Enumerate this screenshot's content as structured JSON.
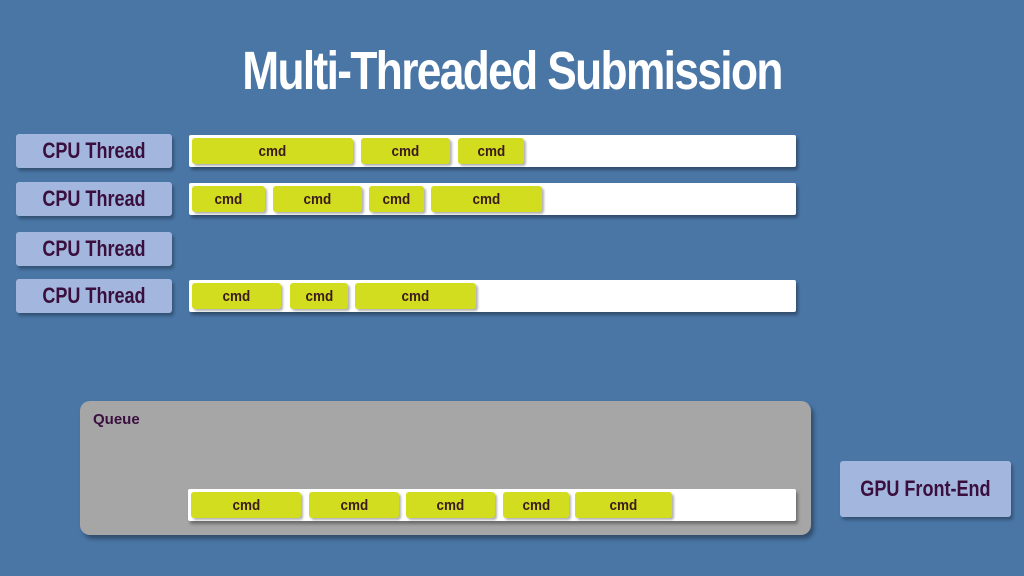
{
  "title": "Multi-Threaded Submission",
  "threads": [
    {
      "label": "CPU Thread",
      "cmds": [
        "cmd",
        "cmd",
        "cmd"
      ]
    },
    {
      "label": "CPU Thread",
      "cmds": [
        "cmd",
        "cmd",
        "cmd",
        "cmd"
      ]
    },
    {
      "label": "CPU Thread",
      "cmds": []
    },
    {
      "label": "CPU Thread",
      "cmds": [
        "cmd",
        "cmd",
        "cmd"
      ]
    }
  ],
  "queue": {
    "label": "Queue",
    "cmds": [
      "cmd",
      "cmd",
      "cmd",
      "cmd",
      "cmd"
    ]
  },
  "gpu": {
    "label": "GPU Front-End"
  },
  "colors": {
    "background": "#4a76a6",
    "label_box": "#a3b7de",
    "cmd": "#d2dd20",
    "queue": "#a6a6a6",
    "text_dark": "#3a0f3e"
  }
}
